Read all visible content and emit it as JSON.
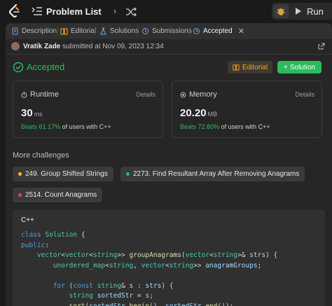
{
  "topbar": {
    "title": "Problem List",
    "run_label": "Run",
    "icons": [
      "logo-icon",
      "list-icon",
      "chevron-left-icon",
      "chevron-right-icon",
      "shuffle-icon",
      "debug-icon",
      "play-icon"
    ]
  },
  "tabs": [
    {
      "label": "Description",
      "icon": "description-icon"
    },
    {
      "label": "Editorial",
      "icon": "book-icon"
    },
    {
      "label": "Solutions",
      "icon": "flask-icon"
    },
    {
      "label": "Submissions",
      "icon": "history-icon"
    },
    {
      "label": "Accepted",
      "icon": "clock-icon"
    }
  ],
  "submission": {
    "user": "Vratik Zade",
    "text": "submitted at Nov 09, 2023 12:34"
  },
  "status": {
    "title": "Accepted",
    "editorial_label": "Editorial",
    "solution_label": "Solution",
    "accent": "#2cbb5d"
  },
  "runtime": {
    "label": "Runtime",
    "details": "Details",
    "value": "30",
    "unit": "ms",
    "beats": "Beats 61.17%",
    "beats_suffix": "of users with C++"
  },
  "memory": {
    "label": "Memory",
    "details": "Details",
    "value": "20.20",
    "unit": "MB",
    "beats": "Beats 72.80%",
    "beats_suffix": "of users with C++"
  },
  "more": {
    "title": "More challenges",
    "items": [
      {
        "label": "249. Group Shifted Strings",
        "color": "#ffc01e"
      },
      {
        "label": "2273. Find Resultant Array After Removing Anagrams",
        "color": "#00b8a3"
      },
      {
        "label": "2514. Count Anagrams",
        "color": "#ff375f"
      }
    ]
  },
  "code": {
    "language": "C++"
  }
}
